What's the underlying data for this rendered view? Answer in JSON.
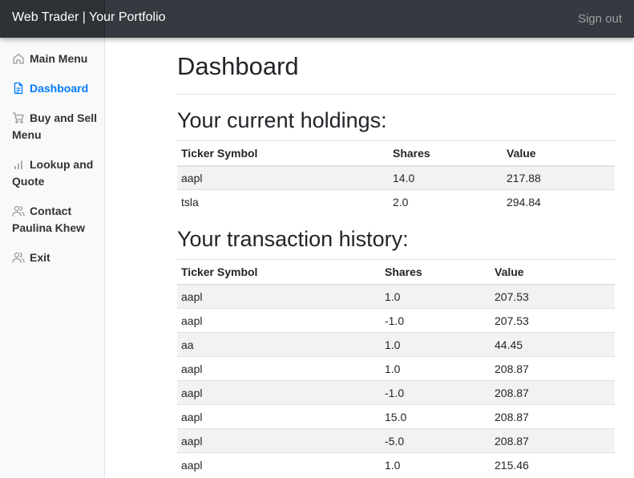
{
  "header": {
    "brand": "Web Trader | Your Portfolio",
    "signout_label": "Sign out"
  },
  "sidebar": {
    "items": [
      {
        "label": "Main Menu",
        "icon": "home-icon"
      },
      {
        "label": "Dashboard",
        "icon": "file-icon",
        "active": true
      },
      {
        "label": "Buy and Sell Menu",
        "icon": "cart-icon"
      },
      {
        "label": "Lookup and Quote",
        "icon": "bar-chart-icon"
      },
      {
        "label": "Contact Paulina Khew",
        "icon": "users-icon"
      },
      {
        "label": "Exit",
        "icon": "users-icon"
      }
    ]
  },
  "main": {
    "title": "Dashboard",
    "holdings": {
      "heading": "Your current holdings:",
      "columns": [
        "Ticker Symbol",
        "Shares",
        "Value"
      ],
      "rows": [
        [
          "aapl",
          "14.0",
          "217.88"
        ],
        [
          "tsla",
          "2.0",
          "294.84"
        ]
      ]
    },
    "history": {
      "heading": "Your transaction history:",
      "columns": [
        "Ticker Symbol",
        "Shares",
        "Value"
      ],
      "rows": [
        [
          "aapl",
          "1.0",
          "207.53"
        ],
        [
          "aapl",
          "-1.0",
          "207.53"
        ],
        [
          "aa",
          "1.0",
          "44.45"
        ],
        [
          "aapl",
          "1.0",
          "208.87"
        ],
        [
          "aapl",
          "-1.0",
          "208.87"
        ],
        [
          "aapl",
          "15.0",
          "208.87"
        ],
        [
          "aapl",
          "-5.0",
          "208.87"
        ],
        [
          "aapl",
          "1.0",
          "215.46"
        ]
      ]
    }
  }
}
